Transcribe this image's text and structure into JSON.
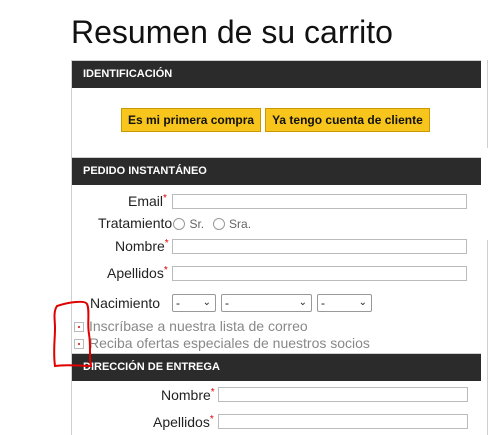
{
  "page": {
    "title": "Resumen de su carrito"
  },
  "identificacion": {
    "header": "IDENTIFICACIÓN",
    "btn_first": "Es mi primera compra",
    "btn_existing": "Ya tengo cuenta de cliente"
  },
  "pedido": {
    "header": "PEDIDO INSTANTÁNEO",
    "email_label": "Email",
    "email_value": "",
    "tratamiento_label": "Tratamiento",
    "sr_label": "Sr.",
    "sra_label": "Sra.",
    "nombre_label": "Nombre",
    "nombre_value": "",
    "apellidos_label": "Apellidos",
    "apellidos_value": "",
    "nacimiento_label": "Nacimiento",
    "day_value": "-",
    "month_value": "-",
    "year_value": "-",
    "newsletter_label": "Inscríbase a nuestra lista de correo",
    "partners_label": "Reciba ofertas especiales de nuestros socios",
    "required_mark": "*"
  },
  "entrega": {
    "header": "DIRECCIÓN DE ENTREGA",
    "nombre_label": "Nombre",
    "nombre_value": "",
    "apellidos_label": "Apellidos",
    "apellidos_value": ""
  },
  "colors": {
    "header_bg": "#2b2b2b",
    "button_bg": "#f7c51c",
    "required": "#dd0000",
    "annotation": "#e00000"
  },
  "icons": [
    "chevron-down-icon",
    "checkbox-icon",
    "radio-icon"
  ]
}
